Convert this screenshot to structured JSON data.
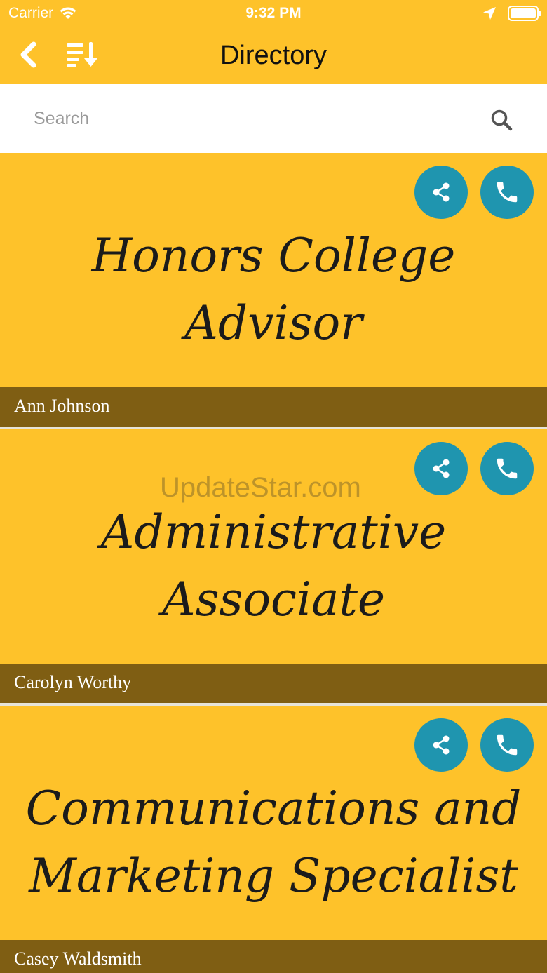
{
  "status_bar": {
    "carrier": "Carrier",
    "time": "9:32 PM",
    "icons": [
      "wifi-icon",
      "location-arrow-icon",
      "battery-icon"
    ]
  },
  "nav": {
    "title": "Directory",
    "back_icon": "chevron-left-icon",
    "sort_icon": "sort-list-icon"
  },
  "search": {
    "placeholder": "Search",
    "value": "",
    "icon": "search-icon"
  },
  "entries": [
    {
      "title": "Honors College Advisor",
      "name": "Ann Johnson"
    },
    {
      "title": "Administrative Associate",
      "name": "Carolyn Worthy"
    },
    {
      "title": "Communications and Marketing Specialist",
      "name": "Casey Waldsmith"
    }
  ],
  "watermark": "UpdateStar.com",
  "colors": {
    "primary": "#FEC22A",
    "name_bar": "#7F5E13",
    "action_button": "#1F95AF",
    "search_bg": "#FFFFFF"
  }
}
